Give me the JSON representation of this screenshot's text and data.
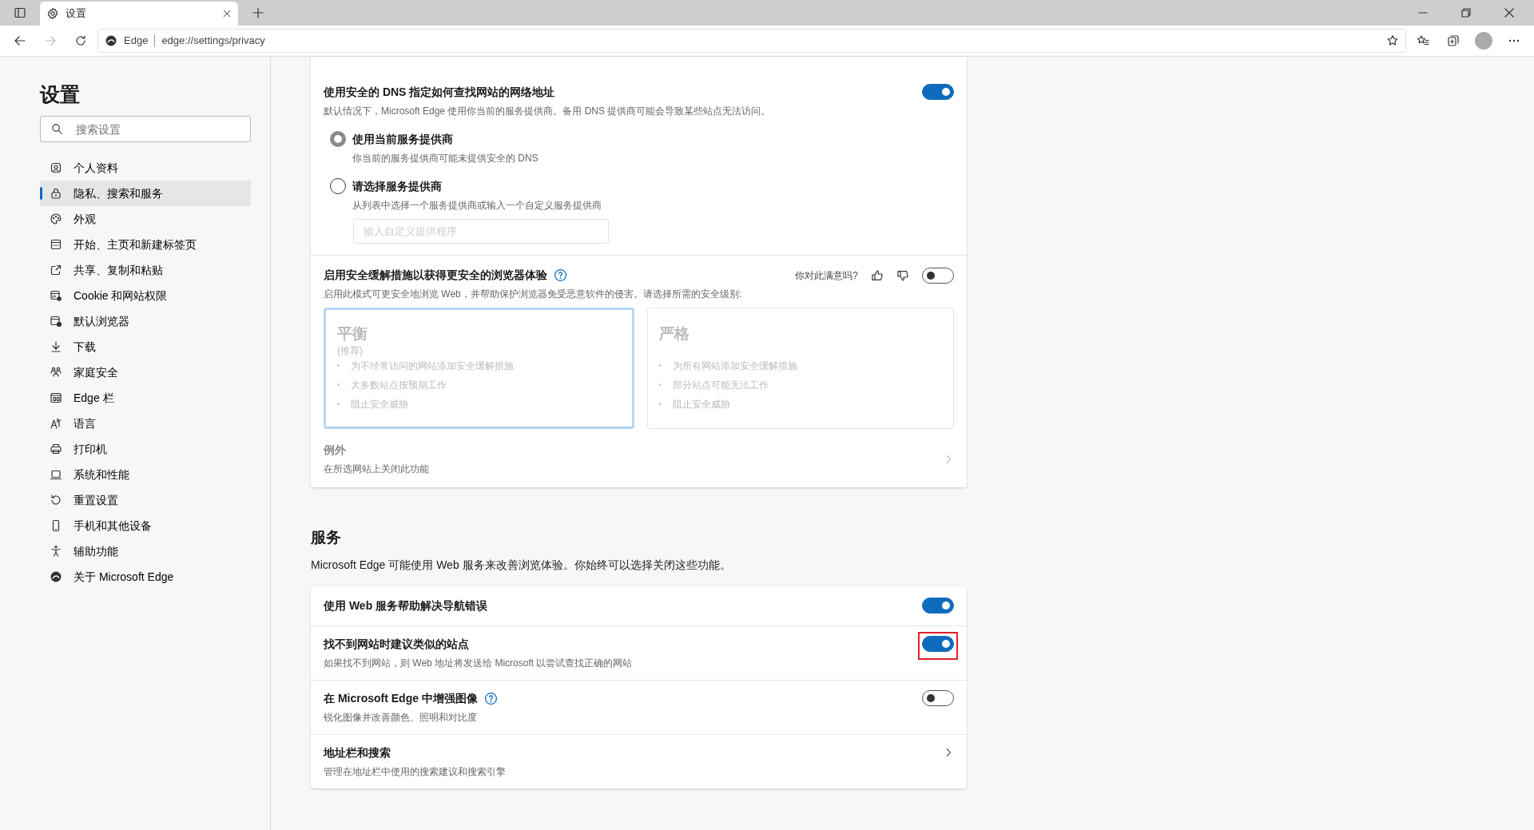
{
  "browser": {
    "tab_title": "设置",
    "site_label": "Edge",
    "url": "edge://settings/privacy"
  },
  "sidebar": {
    "title": "设置",
    "search": {
      "placeholder": "搜索设置"
    },
    "items": [
      {
        "label": "个人资料",
        "selected": false
      },
      {
        "label": "隐私、搜索和服务",
        "selected": true
      },
      {
        "label": "外观",
        "selected": false
      },
      {
        "label": "开始、主页和新建标签页",
        "selected": false
      },
      {
        "label": "共享、复制和粘贴",
        "selected": false
      },
      {
        "label": "Cookie 和网站权限",
        "selected": false
      },
      {
        "label": "默认浏览器",
        "selected": false
      },
      {
        "label": "下载",
        "selected": false
      },
      {
        "label": "家庭安全",
        "selected": false
      },
      {
        "label": "Edge 栏",
        "selected": false
      },
      {
        "label": "语言",
        "selected": false
      },
      {
        "label": "打印机",
        "selected": false
      },
      {
        "label": "系统和性能",
        "selected": false
      },
      {
        "label": "重置设置",
        "selected": false
      },
      {
        "label": "手机和其他设备",
        "selected": false
      },
      {
        "label": "辅助功能",
        "selected": false
      },
      {
        "label": "关于 Microsoft Edge",
        "selected": false
      }
    ]
  },
  "dns": {
    "title": "使用安全的 DNS 指定如何查找网站的网络地址",
    "description": "默认情况下，Microsoft Edge 使用你当前的服务提供商。备用 DNS 提供商可能会导致某些站点无法访问。",
    "on": true,
    "options": [
      {
        "label": "使用当前服务提供商",
        "description": "你当前的服务提供商可能未提供安全的 DNS",
        "selected": true
      },
      {
        "label": "请选择服务提供商",
        "description": "从列表中选择一个服务提供商或输入一个自定义服务提供商",
        "selected": false
      }
    ],
    "custom_input": {
      "placeholder": "输入自定义提供程序"
    }
  },
  "security": {
    "title": "启用安全缓解措施以获得更安全的浏览器体验",
    "help_icon": true,
    "feedback": "你对此满意吗?",
    "on": false,
    "description": "启用此模式可更安全地浏览 Web，并帮助保护浏览器免受恶意软件的侵害。请选择所需的安全级别:",
    "levels": [
      {
        "title": "平衡",
        "subtitle": "(推荐)",
        "bullets": [
          "为不经常访问的网站添加安全缓解措施",
          "大多数站点按预期工作",
          "阻止安全威胁"
        ],
        "selected": true
      },
      {
        "title": "严格",
        "bullets": [
          "为所有网站添加安全缓解措施",
          "部分站点可能无法工作",
          "阻止安全威胁"
        ],
        "selected": false
      }
    ],
    "exceptions": {
      "title": "例外",
      "description": "在所选网站上关闭此功能"
    }
  },
  "services": {
    "heading": "服务",
    "description": "Microsoft Edge 可能使用 Web 服务来改善浏览体验。你始终可以选择关闭这些功能。",
    "rows": [
      {
        "kind": "toggle",
        "title": "使用 Web 服务帮助解决导航错误",
        "on": true,
        "highlighted": false,
        "help_icon": false
      },
      {
        "kind": "toggle",
        "title": "找不到网站时建议类似的站点",
        "description": "如果找不到网站，则 Web 地址将发送给 Microsoft 以尝试查找正确的网站",
        "on": true,
        "highlighted": true,
        "help_icon": false
      },
      {
        "kind": "toggle",
        "title": "在 Microsoft Edge 中增强图像",
        "description": "锐化图像并改善颜色、照明和对比度",
        "on": false,
        "highlighted": false,
        "help_icon": true
      },
      {
        "kind": "link",
        "title": "地址栏和搜索",
        "description": "管理在地址栏中使用的搜索建议和搜索引擎"
      }
    ]
  }
}
